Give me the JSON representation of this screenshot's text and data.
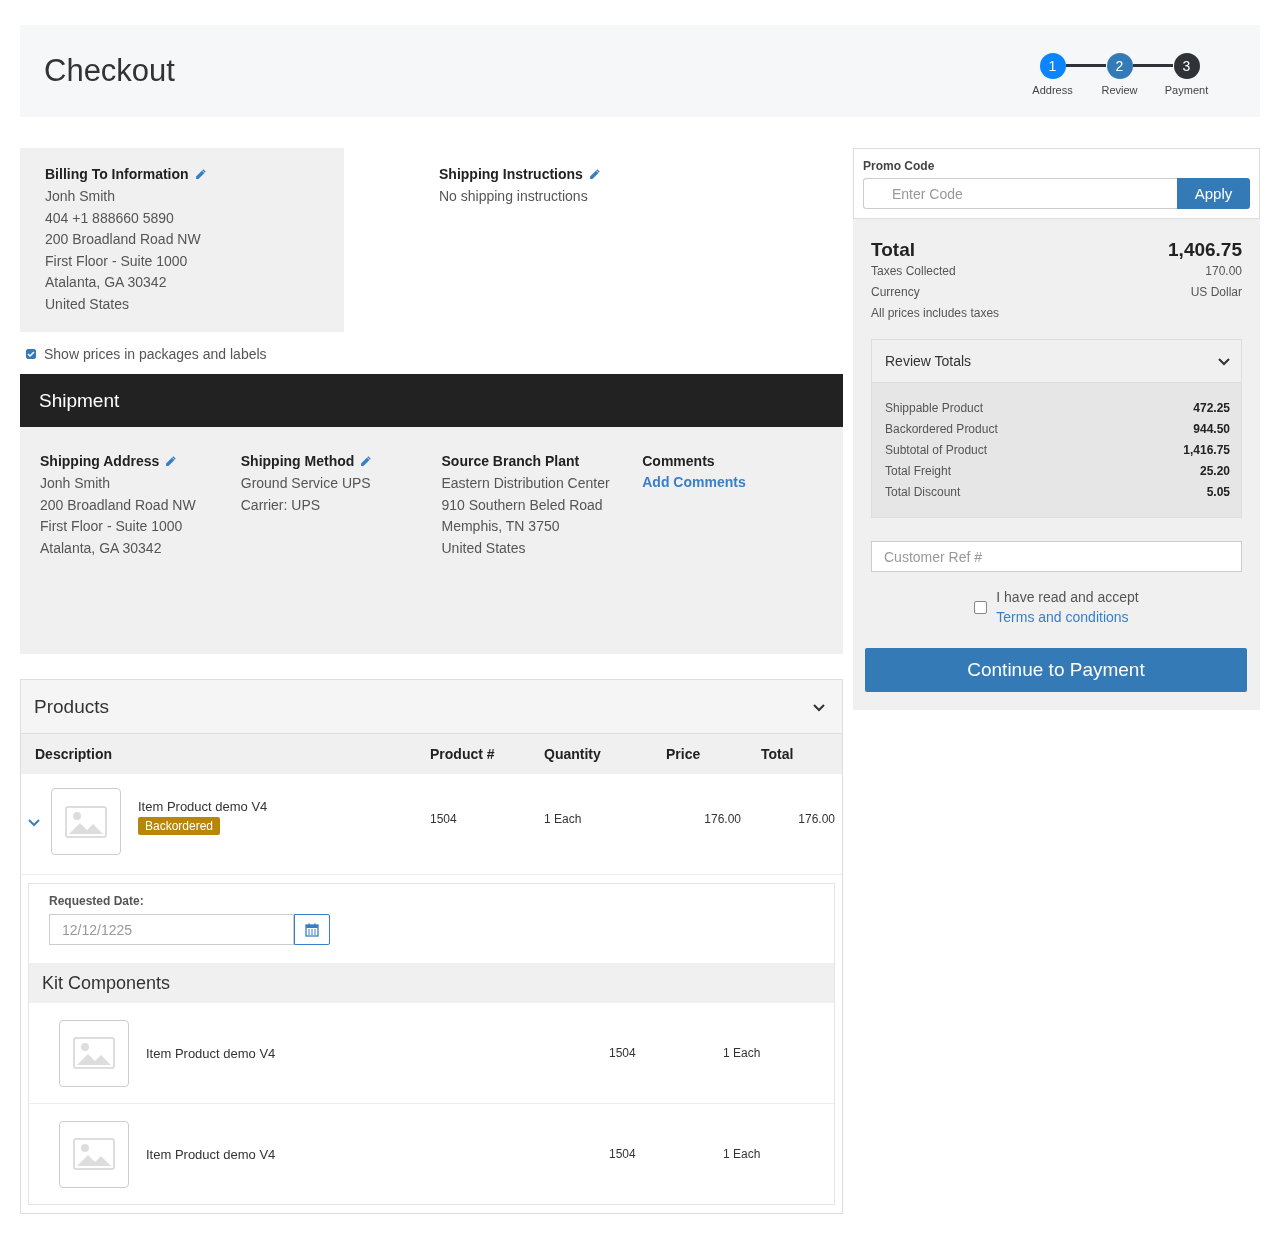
{
  "header": {
    "title": "Checkout",
    "steps": [
      {
        "number": "1",
        "label": "Address",
        "color": "#0a84ff"
      },
      {
        "number": "2",
        "label": "Review",
        "color": "#337ab7"
      },
      {
        "number": "3",
        "label": "Payment",
        "color": "#2f3338"
      }
    ]
  },
  "billing": {
    "title": "Billing To Information",
    "lines": [
      "Jonh Smith",
      "404 +1 888660 5890",
      "200 Broadland Road NW",
      "First Floor - Suite 1000",
      "Atalanta, GA 30342",
      "United States"
    ]
  },
  "shipping_instructions": {
    "title": "Shipping Instructions",
    "text": "No shipping instructions"
  },
  "show_prices": {
    "label": "Show prices in packages and labels",
    "checked": true
  },
  "shipment": {
    "title": "Shipment",
    "columns": [
      {
        "title": "Shipping Address",
        "editable": true,
        "lines": [
          "Jonh Smith",
          "200 Broadland Road NW",
          "First Floor - Suite 1000",
          "Atalanta, GA 30342"
        ]
      },
      {
        "title": "Shipping Method",
        "editable": true,
        "lines": [
          "Ground Service UPS",
          "Carrier: UPS"
        ]
      },
      {
        "title": "Source Branch Plant",
        "editable": false,
        "lines": [
          "Eastern Distribution Center",
          "910 Southern Beled Road",
          "Memphis, TN 3750",
          "United States"
        ]
      },
      {
        "title": "Comments",
        "editable": false,
        "link": "Add Comments"
      }
    ]
  },
  "products": {
    "title": "Products",
    "expanded": true,
    "columns": [
      "Description",
      "Product #",
      "Quantity",
      "Price",
      "Total"
    ],
    "rows": [
      {
        "expanded": true,
        "name": "Item Product demo V4",
        "badge": "Backordered",
        "product_no": "1504",
        "quantity": "1 Each",
        "price": "176.00",
        "total": "176.00",
        "requested_date_label": "Requested Date:",
        "requested_date": "12/12/1225",
        "kit_title": "Kit Components",
        "kit": [
          {
            "name": "Item Product demo V4",
            "product_no": "1504",
            "quantity": "1 Each"
          },
          {
            "name": "Item Product demo V4",
            "product_no": "1504",
            "quantity": "1 Each"
          }
        ]
      }
    ]
  },
  "promo": {
    "label": "Promo Code",
    "placeholder": "Enter Code",
    "button": "Apply"
  },
  "summary": {
    "total_label": "Total",
    "total": "1,406.75",
    "lines": [
      {
        "label": "Taxes Collected",
        "value": "170.00"
      },
      {
        "label": "Currency",
        "value": "US Dollar"
      }
    ],
    "note": "All prices includes taxes"
  },
  "review_totals": {
    "title": "Review Totals",
    "expanded": true,
    "rows": [
      {
        "label": "Shippable Product",
        "value": "472.25"
      },
      {
        "label": "Backordered Product",
        "value": "944.50"
      },
      {
        "label": "Subtotal of Product",
        "value": "1,416.75"
      },
      {
        "label": "Total Freight",
        "value": "25.20"
      },
      {
        "label": "Total Discount",
        "value": "5.05"
      }
    ]
  },
  "customer_ref": {
    "placeholder": "Customer Ref #"
  },
  "terms": {
    "text": "I have read and accept",
    "link": "Terms and conditions",
    "checked": false
  },
  "continue_button": "Continue to Payment"
}
